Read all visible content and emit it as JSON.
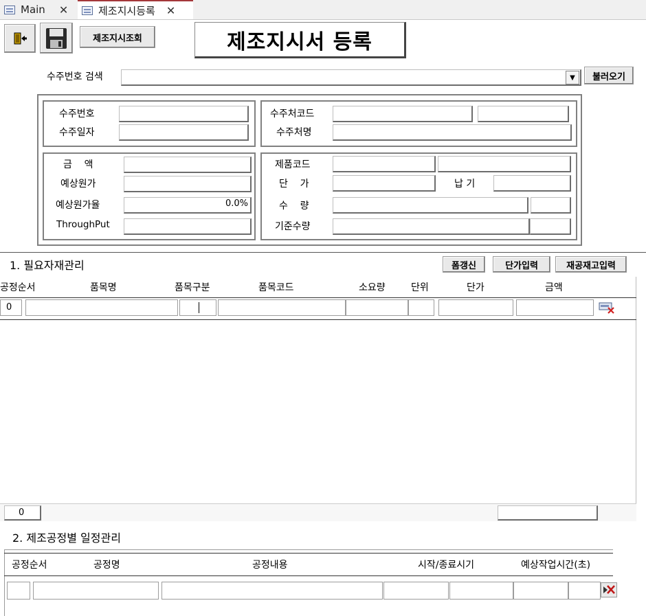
{
  "tabs": [
    {
      "label": "Main",
      "active": false
    },
    {
      "label": "제조지시등록",
      "active": true
    }
  ],
  "toolbar": {
    "exit_icon": "exit-door-icon",
    "save_icon": "save-floppy-icon",
    "lookup_label": "제조지시조회"
  },
  "page_title": "제조지시서 등록",
  "search": {
    "label": "수주번호 검색",
    "value": "",
    "load_label": "불러오기"
  },
  "order_info": {
    "order_no_label": "수주번호",
    "order_date_label": "수주일자",
    "client_code_label": "수주처코드",
    "client_name_label": "수주처명",
    "amount_label": "금    액",
    "expected_cost_label": "예상원가",
    "expected_cost_rate_label": "예상원가율",
    "expected_cost_rate_value": "0.0%",
    "throughput_label": "ThroughPut",
    "product_code_label": "제품코드",
    "unit_price_label": "단    가",
    "delivery_label": "납 기",
    "quantity_label": "수    량",
    "base_qty_label": "기준수량"
  },
  "materials": {
    "title": "1. 필요자재관리",
    "buttons": {
      "refresh": "폼갱신",
      "unit_price": "단가입력",
      "stock": "재공재고입력"
    },
    "columns": [
      "공정순서",
      "품목명",
      "품목구분",
      "품목코드",
      "소요량",
      "단위",
      "단가",
      "금액"
    ],
    "row_seq": "0",
    "footer_count": "0"
  },
  "process": {
    "title": "2. 제조공정별 일정관리",
    "columns": [
      "공정순서",
      "공정명",
      "공정내용",
      "시작/종료시기",
      "예상작업시간(초)"
    ]
  },
  "colors": {
    "tab_accent": "#a4373a"
  }
}
